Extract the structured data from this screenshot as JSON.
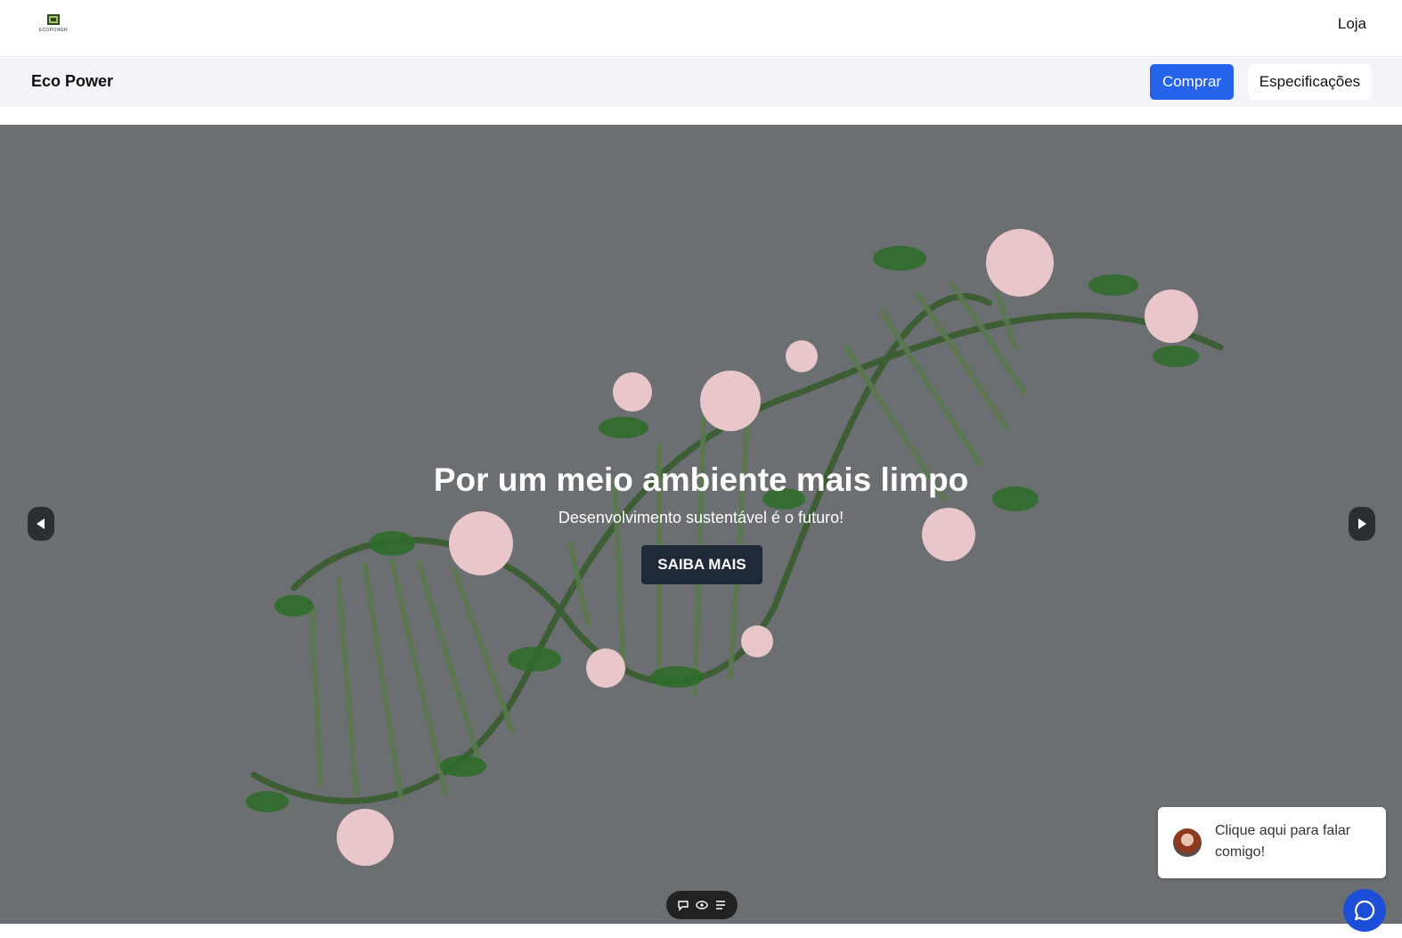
{
  "topbar": {
    "logo_text": "ECOPOWER",
    "nav_link": "Loja"
  },
  "subnav": {
    "brand": "Eco Power",
    "buy_label": "Comprar",
    "specs_label": "Especificações"
  },
  "hero": {
    "title": "Por um meio ambiente mais limpo",
    "subtitle": "Desenvolvimento sustentável é o futuro!",
    "cta_label": "SAIBA MAIS",
    "background_color": "#6b6f71"
  },
  "carousel": {
    "prev_icon": "triangle-left-icon",
    "next_icon": "triangle-right-icon"
  },
  "toolbar": {
    "icons": [
      "comment-icon",
      "eye-icon",
      "list-icon"
    ]
  },
  "chat": {
    "message": "Clique aqui para falar comigo!",
    "fab_icon": "chat-bubble-icon"
  },
  "colors": {
    "primary": "#2563eb",
    "dark": "#1f2937",
    "chat_fab": "#1d4ed8"
  }
}
